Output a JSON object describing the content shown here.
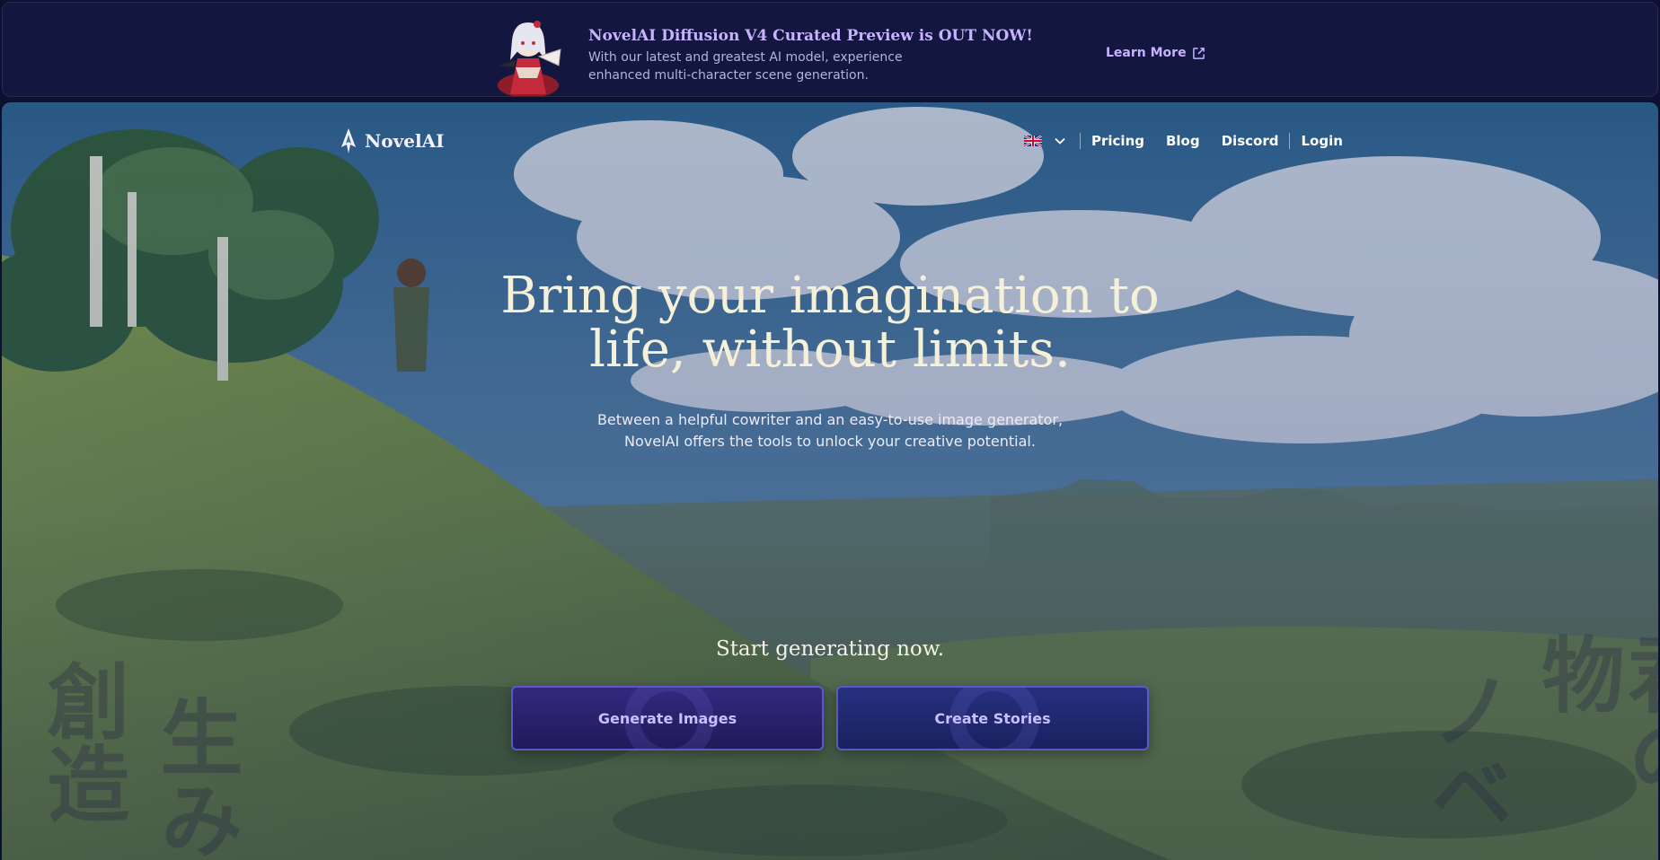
{
  "banner": {
    "title": "NovelAI Diffusion V4 Curated Preview is OUT NOW!",
    "description": "With our latest and greatest AI model, experience enhanced multi-character scene generation.",
    "learn_more": "Learn More",
    "art_icon": "anime-character-illustration",
    "link_icon": "external-link-icon"
  },
  "header": {
    "logo_text": "NovelAI",
    "language_flag": "uk-flag-icon",
    "nav": {
      "pricing": "Pricing",
      "blog": "Blog",
      "discord": "Discord",
      "login": "Login"
    }
  },
  "hero": {
    "headline_line1": "Bring your imagination to",
    "headline_line2": "life, without limits.",
    "subtext_line1": "Between a helpful cowriter and an easy-to-use image generator,",
    "subtext_line2": "NovelAI offers the tools to unlock your creative potential.",
    "start_text": "Start generating now.",
    "generate_images": "Generate Images",
    "create_stories": "Create Stories",
    "kanji_left_1": "創造",
    "kanji_left_2": "生み",
    "kanji_right_1": "ノベ",
    "kanji_right_2": "君の物"
  },
  "colors": {
    "banner_bg": "#13163f",
    "accent": "#c6b2ff",
    "headline": "#f5f0d8"
  }
}
